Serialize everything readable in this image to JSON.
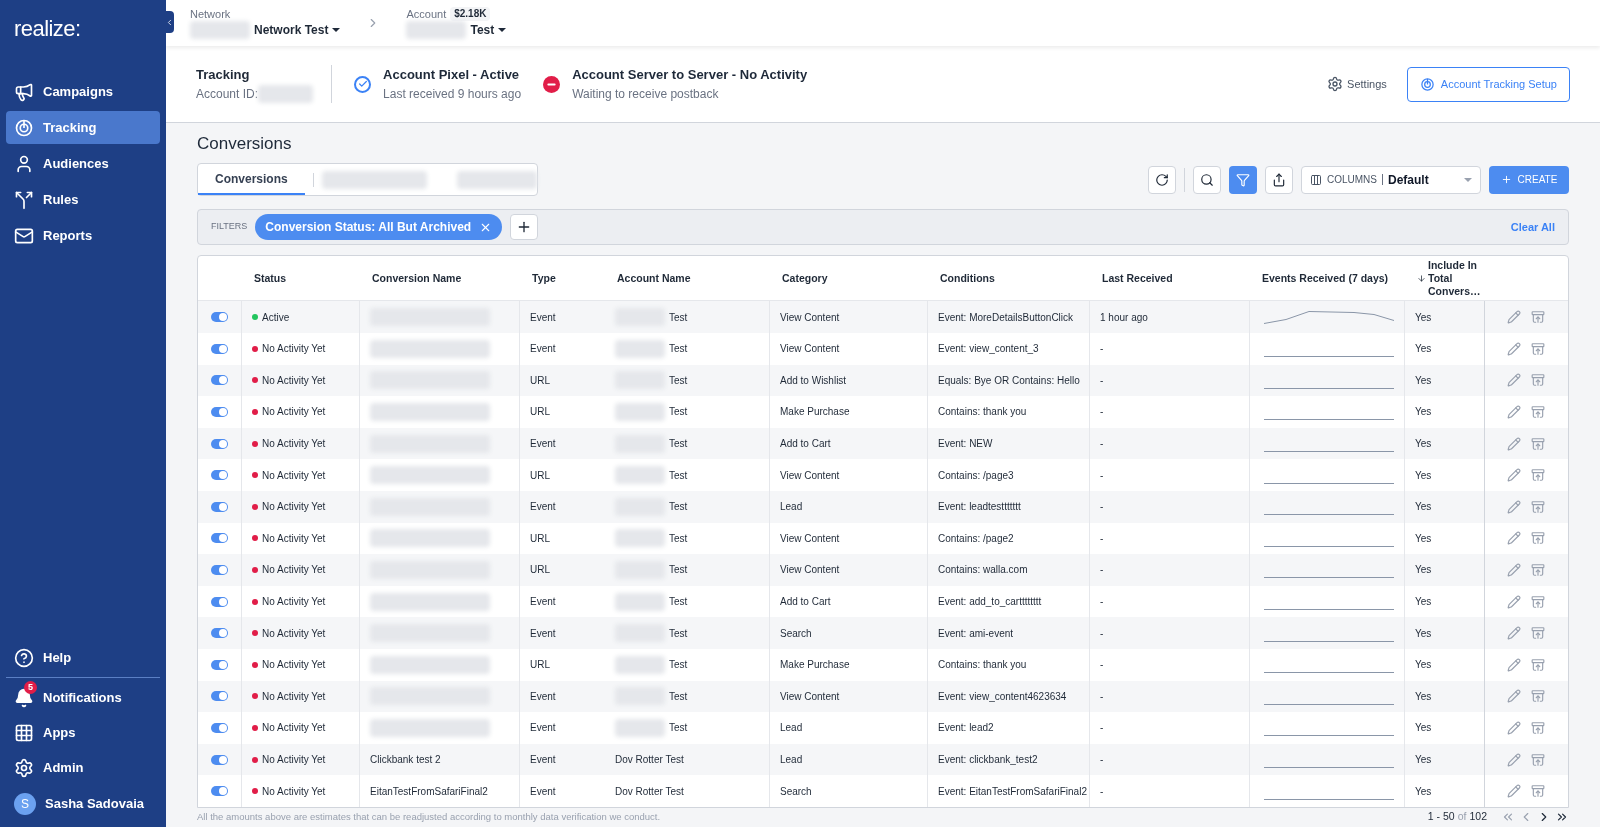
{
  "sidebar": {
    "logo": "realize:",
    "items": [
      {
        "label": "Campaigns",
        "selected": false
      },
      {
        "label": "Tracking",
        "selected": true
      },
      {
        "label": "Audiences",
        "selected": false
      },
      {
        "label": "Rules",
        "selected": false
      },
      {
        "label": "Reports",
        "selected": false
      }
    ],
    "bottom_items": [
      {
        "label": "Help"
      },
      {
        "label": "Notifications",
        "badge": "5"
      },
      {
        "label": "Apps"
      },
      {
        "label": "Admin"
      }
    ],
    "user": {
      "initial": "S",
      "name": "Sasha Sadovaia"
    }
  },
  "breadcrumb": {
    "network": {
      "label": "Network",
      "value": "Network Test"
    },
    "account": {
      "label": "Account",
      "badge": "$2.18K",
      "value": "Test"
    }
  },
  "tracking_bar": {
    "title": "Tracking",
    "account_id_label": "Account ID:",
    "statuses": [
      {
        "kind": "ok",
        "title": "Account Pixel - Active",
        "subtitle": "Last received 9 hours ago"
      },
      {
        "kind": "error",
        "title": "Account Server to Server - No Activity",
        "subtitle": "Waiting to receive postback"
      }
    ],
    "settings": "Settings",
    "setup_button": "Account Tracking Setup"
  },
  "page_title": "Conversions",
  "tabs": [
    {
      "label": "Conversions",
      "selected": true
    }
  ],
  "toolbar": {
    "columns_label": "COLUMNS",
    "columns_value": "Default",
    "create": "CREATE",
    "filter_active": true
  },
  "filters": {
    "label": "FILTERS",
    "chips": [
      "Conversion Status: All But Archived"
    ],
    "clear": "Clear All"
  },
  "table": {
    "columns": [
      "Status",
      "Conversion Name",
      "Type",
      "Account Name",
      "Category",
      "Conditions",
      "Last Received",
      "Events Received (7 days)",
      "Include In Total Convers…"
    ],
    "rows": [
      {
        "on": true,
        "status": "Active",
        "color": "#22c55e",
        "type": "Event",
        "account": "Test",
        "category": "View Content",
        "conditions": "Event: MoreDetailsButtonClick",
        "last": "1 hour ago",
        "kind": "active",
        "include": "Yes"
      },
      {
        "on": true,
        "status": "No Activity Yet",
        "color": "#e11d48",
        "type": "Event",
        "account": "Test",
        "category": "View Content",
        "conditions": "Event: view_content_3",
        "last": "-",
        "kind": "flat",
        "include": "Yes"
      },
      {
        "on": true,
        "status": "No Activity Yet",
        "color": "#e11d48",
        "type": "URL",
        "account": "Test",
        "category": "Add to Wishlist",
        "conditions": "Equals: Bye OR Contains: Hello",
        "last": "-",
        "kind": "flat",
        "include": "Yes"
      },
      {
        "on": true,
        "status": "No Activity Yet",
        "color": "#e11d48",
        "type": "URL",
        "account": "Test",
        "category": "Make Purchase",
        "conditions": "Contains: thank you",
        "last": "-",
        "kind": "flat",
        "include": "Yes"
      },
      {
        "on": true,
        "status": "No Activity Yet",
        "color": "#e11d48",
        "type": "Event",
        "account": "Test",
        "category": "Add to Cart",
        "conditions": "Event: NEW",
        "last": "-",
        "kind": "flat",
        "include": "Yes"
      },
      {
        "on": true,
        "status": "No Activity Yet",
        "color": "#e11d48",
        "type": "URL",
        "account": "Test",
        "category": "View Content",
        "conditions": "Contains: /page3",
        "last": "-",
        "kind": "flat",
        "include": "Yes"
      },
      {
        "on": true,
        "status": "No Activity Yet",
        "color": "#e11d48",
        "type": "Event",
        "account": "Test",
        "category": "Lead",
        "conditions": "Event: leadtesttttttt",
        "last": "-",
        "kind": "flat",
        "include": "Yes"
      },
      {
        "on": true,
        "status": "No Activity Yet",
        "color": "#e11d48",
        "type": "URL",
        "account": "Test",
        "category": "View Content",
        "conditions": "Contains: /page2",
        "last": "-",
        "kind": "flat",
        "include": "Yes"
      },
      {
        "on": true,
        "status": "No Activity Yet",
        "color": "#e11d48",
        "type": "URL",
        "account": "Test",
        "category": "View Content",
        "conditions": "Contains: walla.com",
        "last": "-",
        "kind": "flat",
        "include": "Yes"
      },
      {
        "on": true,
        "status": "No Activity Yet",
        "color": "#e11d48",
        "type": "Event",
        "account": "Test",
        "category": "Add to Cart",
        "conditions": "Event: add_to_cartttttttt",
        "last": "-",
        "kind": "flat",
        "include": "Yes"
      },
      {
        "on": true,
        "status": "No Activity Yet",
        "color": "#e11d48",
        "type": "Event",
        "account": "Test",
        "category": "Search",
        "conditions": "Event: ami-event",
        "last": "-",
        "kind": "flat",
        "include": "Yes"
      },
      {
        "on": true,
        "status": "No Activity Yet",
        "color": "#e11d48",
        "type": "URL",
        "account": "Test",
        "category": "Make Purchase",
        "conditions": "Contains: thank you",
        "last": "-",
        "kind": "flat",
        "include": "Yes"
      },
      {
        "on": true,
        "status": "No Activity Yet",
        "color": "#e11d48",
        "type": "Event",
        "account": "Test",
        "category": "View Content",
        "conditions": "Event: view_content4623634",
        "last": "-",
        "kind": "flat",
        "include": "Yes"
      },
      {
        "on": true,
        "status": "No Activity Yet",
        "color": "#e11d48",
        "type": "Event",
        "account": "Test",
        "category": "Lead",
        "conditions": "Event: lead2",
        "last": "-",
        "kind": "flat",
        "include": "Yes"
      },
      {
        "on": true,
        "status": "No Activity Yet",
        "color": "#e11d48",
        "name": "Clickbank test 2",
        "type": "Event",
        "account": "Dov Rotter Test",
        "category": "Lead",
        "conditions": "Event: clickbank_test2",
        "last": "-",
        "kind": "flat",
        "include": "Yes"
      },
      {
        "on": true,
        "status": "No Activity Yet",
        "color": "#e11d48",
        "name": "EitanTestFromSafariFinal2",
        "type": "Event",
        "account": "Dov Rotter Test",
        "category": "Search",
        "conditions": "Event: EitanTestFromSafariFinal2",
        "last": "-",
        "kind": "flat",
        "include": "Yes"
      }
    ]
  },
  "footer": {
    "note": "All the amounts above are estimates that can be readjusted according to monthly data verification we conduct.",
    "range": "1 - 50",
    "of": "of",
    "total": "102"
  }
}
